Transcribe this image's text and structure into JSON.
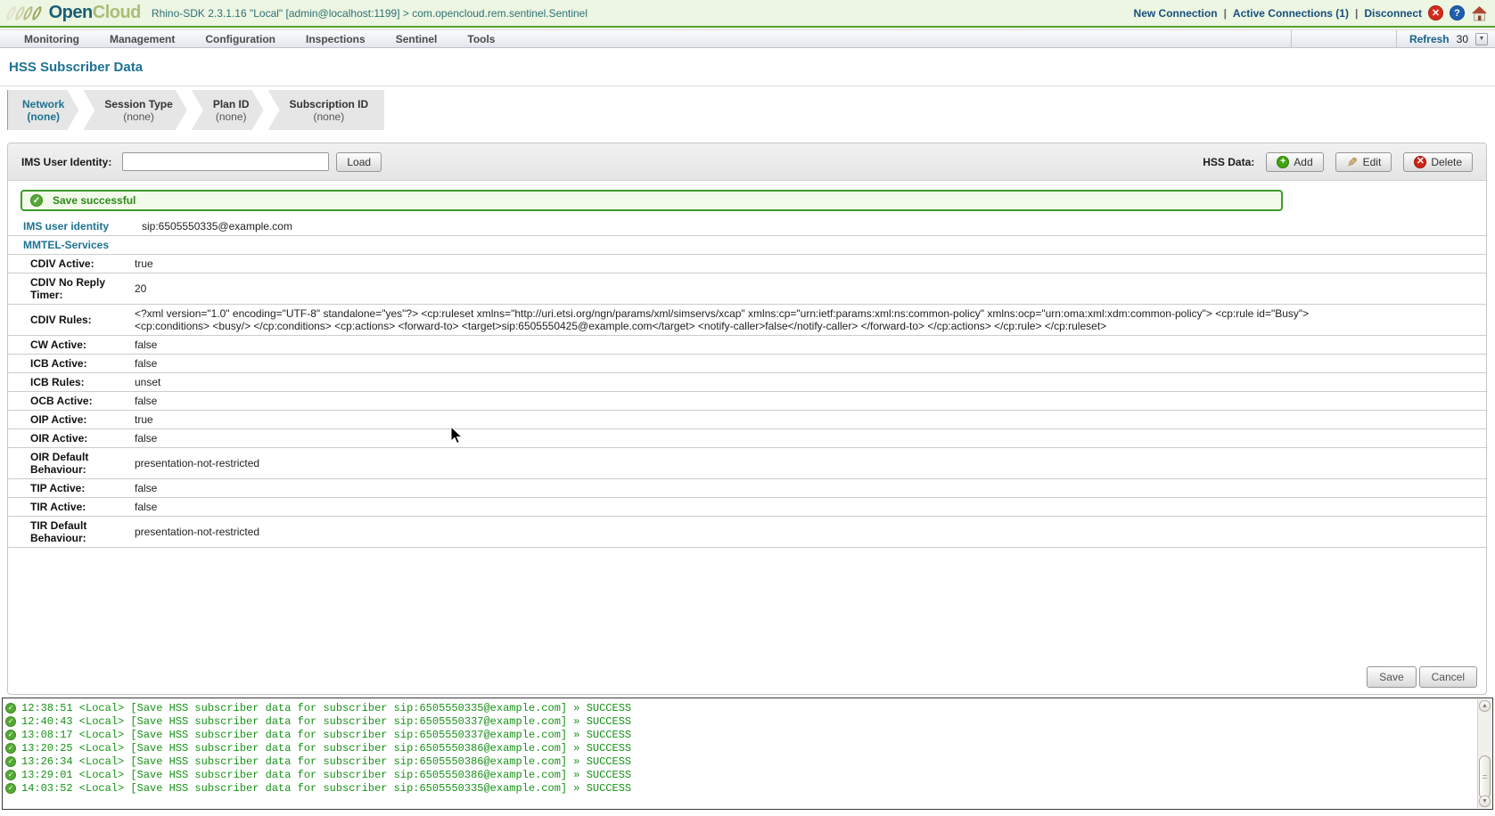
{
  "colors": {
    "brand_teal": "#1d7292",
    "brand_olive": "#a9bd77",
    "header_green_line": "#55a02e",
    "success_green": "#3f9b2e",
    "log_green": "#169216"
  },
  "header": {
    "logo_open": "Open",
    "logo_cloud": "Cloud",
    "title": "Rhino-SDK 2.3.1.16 \"Local\" [admin@localhost:1199] > com.opencloud.rem.sentinel.Sentinel",
    "link_new_connection": "New Connection",
    "link_active_connections": "Active Connections (1)",
    "link_disconnect": "Disconnect",
    "pipe": "|",
    "close_glyph": "✕",
    "help_glyph": "?"
  },
  "menubar": {
    "items": [
      "Monitoring",
      "Management",
      "Configuration",
      "Inspections",
      "Sentinel",
      "Tools"
    ],
    "refresh_label": "Refresh",
    "refresh_value": "30",
    "stepper_glyph": "▼"
  },
  "page_title": "HSS Subscriber Data",
  "wizard": {
    "steps": [
      {
        "label": "Network",
        "value": "(none)"
      },
      {
        "label": "Session Type",
        "value": "(none)"
      },
      {
        "label": "Plan ID",
        "value": "(none)"
      },
      {
        "label": "Subscription ID",
        "value": "(none)"
      }
    ]
  },
  "toolbar": {
    "ims_label": "IMS User Identity:",
    "ims_value": "",
    "load_label": "Load",
    "hss_data_label": "HSS Data:",
    "add_label": "Add",
    "edit_label": "Edit",
    "delete_label": "Delete",
    "add_glyph": "+",
    "edit_glyph": "✎",
    "delete_glyph": "✕"
  },
  "banner": {
    "text": "Save successful",
    "check_glyph": "✓"
  },
  "subscriber_table": {
    "rows": [
      {
        "label": "IMS user identity",
        "value": "sip:6505550335@example.com",
        "style": "teal"
      },
      {
        "label": "MMTEL-Services",
        "value": "",
        "style": "section"
      },
      {
        "label": "CDIV Active:",
        "value": "true"
      },
      {
        "label": "CDIV No Reply Timer:",
        "value": "20"
      },
      {
        "label": "CDIV Rules:",
        "value": "<?xml version=\"1.0\" encoding=\"UTF-8\" standalone=\"yes\"?> <cp:ruleset xmlns=\"http://uri.etsi.org/ngn/params/xml/simservs/xcap\" xmlns:cp=\"urn:ietf:params:xml:ns:common-policy\" xmlns:ocp=\"urn:oma:xml:xdm:common-policy\"> <cp:rule id=\"Busy\"> <cp:conditions> <busy/> </cp:conditions> <cp:actions> <forward-to> <target>sip:6505550425@example.com</target> <notify-caller>false</notify-caller> </forward-to> </cp:actions> </cp:rule> </cp:ruleset>"
      },
      {
        "label": "CW Active:",
        "value": "false"
      },
      {
        "label": "ICB Active:",
        "value": "false"
      },
      {
        "label": "ICB Rules:",
        "value": "unset"
      },
      {
        "label": "OCB Active:",
        "value": "false"
      },
      {
        "label": "OIP Active:",
        "value": "true"
      },
      {
        "label": "OIR Active:",
        "value": "false"
      },
      {
        "label": "OIR Default Behaviour:",
        "value": "presentation-not-restricted"
      },
      {
        "label": "TIP Active:",
        "value": "false"
      },
      {
        "label": "TIR Active:",
        "value": "false"
      },
      {
        "label": "TIR Default Behaviour:",
        "value": "presentation-not-restricted"
      }
    ]
  },
  "form_actions": {
    "save": "Save",
    "cancel": "Cancel"
  },
  "console": {
    "check_glyph": "✓",
    "entries": [
      "12:38:51 <Local> [Save HSS subscriber data for subscriber sip:6505550335@example.com] » SUCCESS",
      "12:40:43 <Local> [Save HSS subscriber data for subscriber sip:6505550337@example.com] » SUCCESS",
      "13:08:17 <Local> [Save HSS subscriber data for subscriber sip:6505550337@example.com] » SUCCESS",
      "13:20:25 <Local> [Save HSS subscriber data for subscriber sip:6505550386@example.com] » SUCCESS",
      "13:26:34 <Local> [Save HSS subscriber data for subscriber sip:6505550386@example.com] » SUCCESS",
      "13:29:01 <Local> [Save HSS subscriber data for subscriber sip:6505550386@example.com] » SUCCESS",
      "14:03:52 <Local> [Save HSS subscriber data for subscriber sip:6505550335@example.com] » SUCCESS"
    ]
  }
}
